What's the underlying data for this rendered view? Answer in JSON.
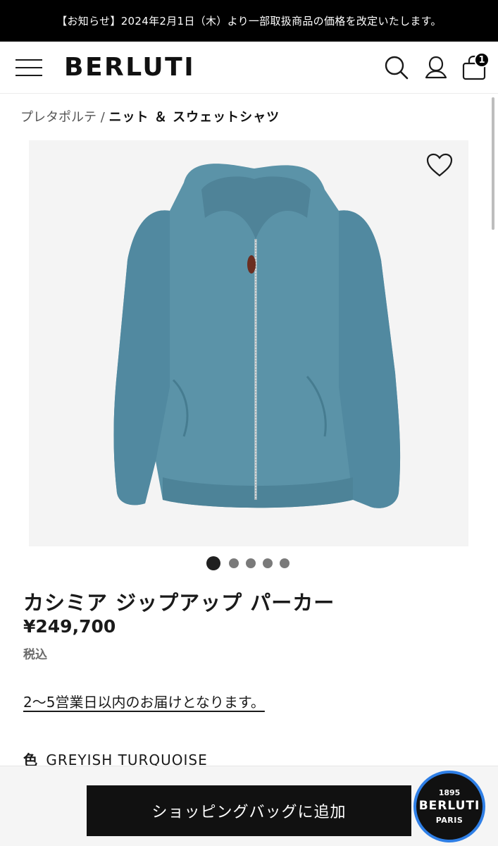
{
  "announcement": "【お知らせ】2024年2月1日（木）より一部取扱商品の価格を改定いたします。",
  "header": {
    "logo": "BERLUTI",
    "icons": [
      "menu-icon",
      "search-icon",
      "account-icon",
      "shopping-bag-icon"
    ],
    "bag_count": "1"
  },
  "breadcrumb": {
    "parent": "プレタポルテ",
    "separator": "/",
    "current": "ニット ＆ スウェットシャツ"
  },
  "gallery": {
    "total_images": 5,
    "active_index": 1,
    "product_color": "#5b93a8"
  },
  "product": {
    "name": "カシミア ジップアップ パーカー",
    "price": "¥249,700",
    "tax_note": "税込",
    "delivery_note": "2〜5営業日以内のお届けとなります。",
    "color_label": "色",
    "color_value": "GREYISH TURQUOISE"
  },
  "actions": {
    "add_to_bag": "ショッピングバッグに追加"
  },
  "seal": {
    "year": "1895",
    "brand": "BERLUTI",
    "city": "PARIS"
  },
  "colors": {
    "announcement_bg": "#000000",
    "button_bg": "#111111",
    "seal_ring": "#2f7fe6"
  }
}
